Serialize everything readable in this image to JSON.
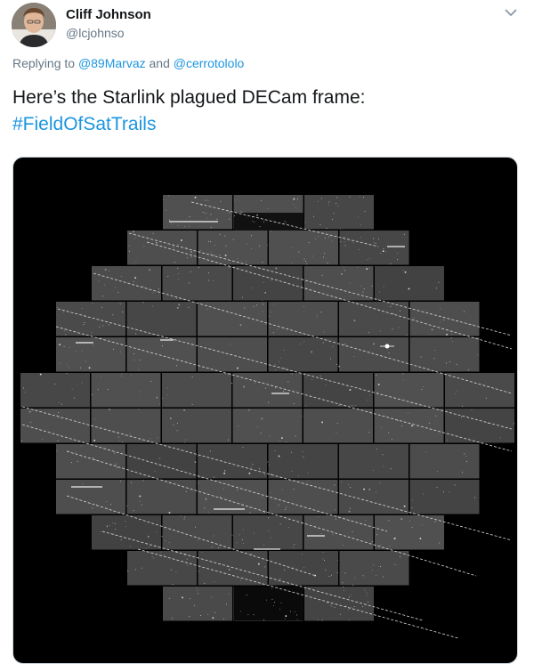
{
  "tweet": {
    "author": {
      "name": "Cliff Johnson",
      "handle": "@lcjohnso",
      "avatar_icon": "user-avatar-photo"
    },
    "menu_icon": "chevron-down-icon",
    "reply_to": {
      "prefix": "Replying to",
      "users": [
        "@89Marvaz",
        "@cerrotololo"
      ],
      "joiner": "and"
    },
    "text": "Here’s the Starlink plagued DECam frame:",
    "hashtag": "#FieldOfSatTrails",
    "media": {
      "kind": "image",
      "description_icon": "decam-mosaic-image"
    }
  },
  "colors": {
    "link": "#1b95e0",
    "secondary_text": "#657786",
    "primary_text": "#14171a",
    "ccd_gray": "#4a4a4a",
    "background": "#000000"
  }
}
